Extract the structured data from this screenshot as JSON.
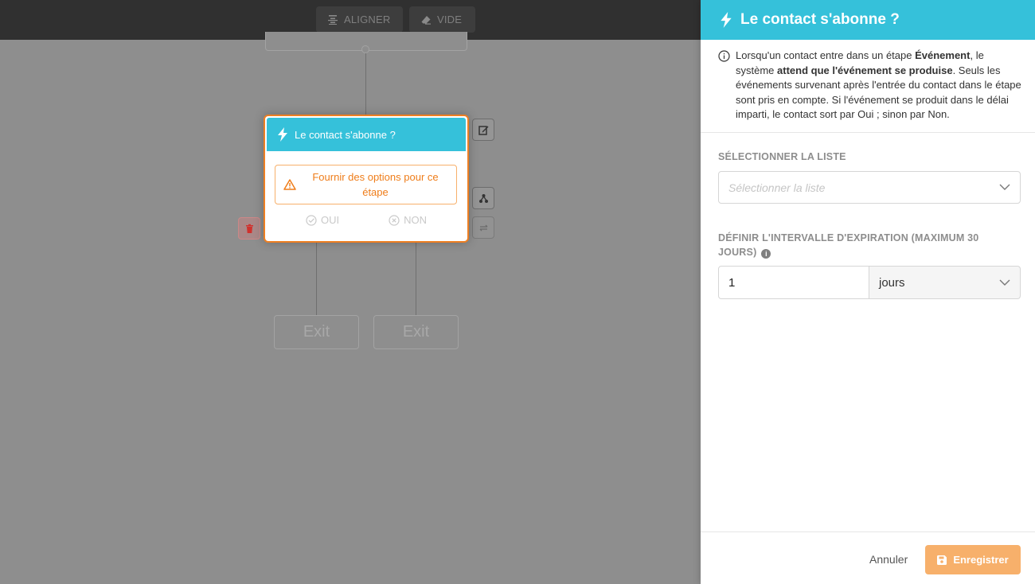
{
  "toolbar": {
    "align_label": "ALIGNER",
    "empty_label": "VIDE"
  },
  "step": {
    "title": "Le contact s'abonne ?",
    "warning": "Fournir des options pour ce étape",
    "yes_label": "OUI",
    "no_label": "NON"
  },
  "exits": [
    "Exit",
    "Exit"
  ],
  "panel": {
    "title": "Le contact s'abonne ?",
    "info": {
      "part1": "Lorsqu'un contact entre dans un étape ",
      "bold1": "Événement",
      "part2": ", le système ",
      "bold2": "attend que l'événement se produise",
      "part3": ". Seuls les événements survenant après l'entrée du contact dans le étape sont pris en compte. Si l'événement se produit dans le délai imparti, le contact sort par Oui ; sinon par Non."
    },
    "list_label": "SÉLECTIONNER LA LISTE",
    "list_placeholder": "Sélectionner la liste",
    "expiration_label": "DÉFINIR L'INTERVALLE D'EXPIRATION (MAXIMUM 30 JOURS)",
    "expiration_value": "1",
    "expiration_unit": "jours",
    "cancel_label": "Annuler",
    "save_label": "Enregistrer"
  },
  "colors": {
    "accent": "#35c1da",
    "warning": "#ef7d1a",
    "save": "#f7b06b"
  }
}
